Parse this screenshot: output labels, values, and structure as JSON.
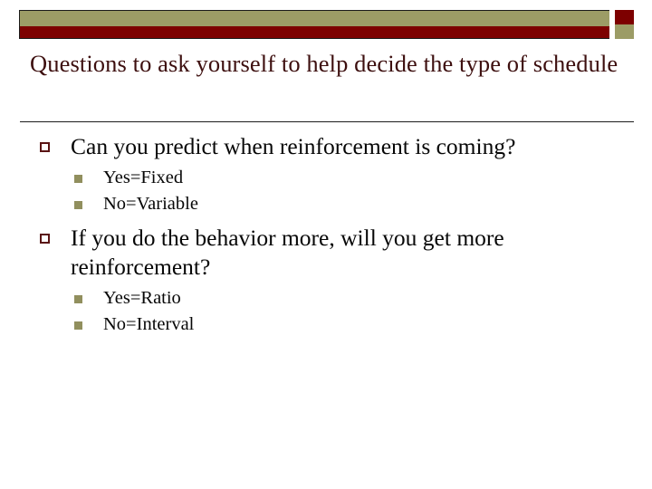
{
  "slide": {
    "title": "Questions to ask yourself to help decide the type of schedule",
    "bullets": [
      {
        "text": "Can you predict when reinforcement is coming?",
        "sub": [
          "Yes=Fixed",
          "No=Variable"
        ]
      },
      {
        "text": "If you do the behavior more, will you get more reinforcement?",
        "sub": [
          "Yes=Ratio",
          "No=Interval"
        ]
      }
    ]
  },
  "theme": {
    "olive": "#9c9c66",
    "maroon": "#7d0000",
    "title_color": "#3d0f0f",
    "body_color": "#070707",
    "bullet_outline": "#5a1414",
    "subbullet_fill": "#918f5e",
    "background": "#ffffff"
  },
  "decor": {
    "banner_olive_name": "olive-band",
    "banner_maroon_name": "maroon-band",
    "checker_name": "checker-accent"
  }
}
